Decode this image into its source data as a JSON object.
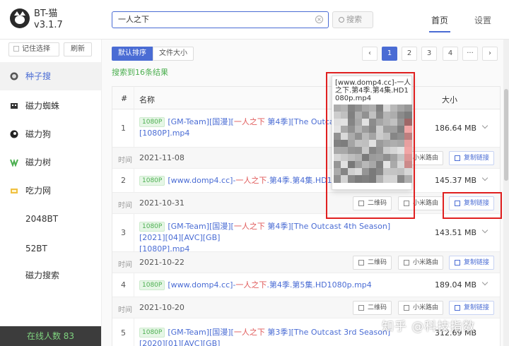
{
  "app": {
    "name": "BT-猫",
    "version": "v3.1.7"
  },
  "search": {
    "value": "一人之下",
    "button": "搜索"
  },
  "nav": {
    "home": "首页",
    "settings": "设置"
  },
  "sidebar": {
    "remember": "记住选择",
    "refresh": "刷新",
    "items": [
      {
        "label": "种子搜",
        "icon": "globe-icon",
        "active": true
      },
      {
        "label": "磁力蜘蛛",
        "icon": "spider-icon"
      },
      {
        "label": "磁力狗",
        "icon": "dog-icon"
      },
      {
        "label": "磁力树",
        "icon": "tree-icon"
      },
      {
        "label": "吃力网",
        "icon": "bowl-icon"
      },
      {
        "label": "2048BT"
      },
      {
        "label": "52BT"
      },
      {
        "label": "磁力搜索"
      }
    ],
    "online": "在线人数 83"
  },
  "toolbar": {
    "sort_default": "默认排序",
    "sort_size": "文件大小"
  },
  "pagination": {
    "pages": [
      "1",
      "2",
      "3",
      "4",
      "···"
    ],
    "active": "1"
  },
  "result_count": "搜索到16条结果",
  "table": {
    "headers": {
      "num": "#",
      "name": "名称",
      "size": "大小"
    },
    "time_label": "时间",
    "actions": {
      "qr": "二维码",
      "router": "小米路由",
      "copy": "复制链接"
    },
    "rows": [
      {
        "num": "1",
        "tag": "1080P",
        "pre": "[GM-Team][国漫][",
        "hl": "一人之下",
        "post": " 第4季][The Outcast 4th S",
        "line2": "[1080P].mp4",
        "size": "186.64 MB",
        "date": "2021-11-08"
      },
      {
        "num": "2",
        "tag": "1080P",
        "pre": "[www.domp4.cc]-",
        "hl": "一人之下",
        "post": ".第4季.第4集.HD1080p.mp4",
        "line2": "",
        "size": "145.37 MB",
        "date": "2021-10-31"
      },
      {
        "num": "3",
        "tag": "1080P",
        "pre": "[GM-Team][国漫][",
        "hl": "一人之下",
        "post": " 第4季][The Outcast 4th Season][2021][04][AVC][GB]",
        "line2": "[1080P].mp4",
        "size": "143.51 MB",
        "date": "2021-10-22"
      },
      {
        "num": "4",
        "tag": "1080P",
        "pre": "[www.domp4.cc]-",
        "hl": "一人之下",
        "post": ".第4季.第5集.HD1080p.mp4",
        "line2": "",
        "size": "189.04 MB",
        "date": "2021-10-20"
      },
      {
        "num": "5",
        "tag": "1080P",
        "pre": "[GM-Team][国漫][",
        "hl": "一人之下",
        "post": " 第3季][The Outcast 3rd Season][2020][01][AVC][GB]",
        "line2": "",
        "size": "312.69 MB",
        "date": ""
      }
    ]
  },
  "qr_popup": {
    "title": "[www.domp4.cc]-一人之下.第4季.第4集.HD1080p.mp4"
  },
  "watermark": "知乎 @科技指数",
  "colors": {
    "accent": "#4a6cd4",
    "highlight": "#e05a5a",
    "tag": "#4caf50",
    "annotation": "#e02020"
  }
}
